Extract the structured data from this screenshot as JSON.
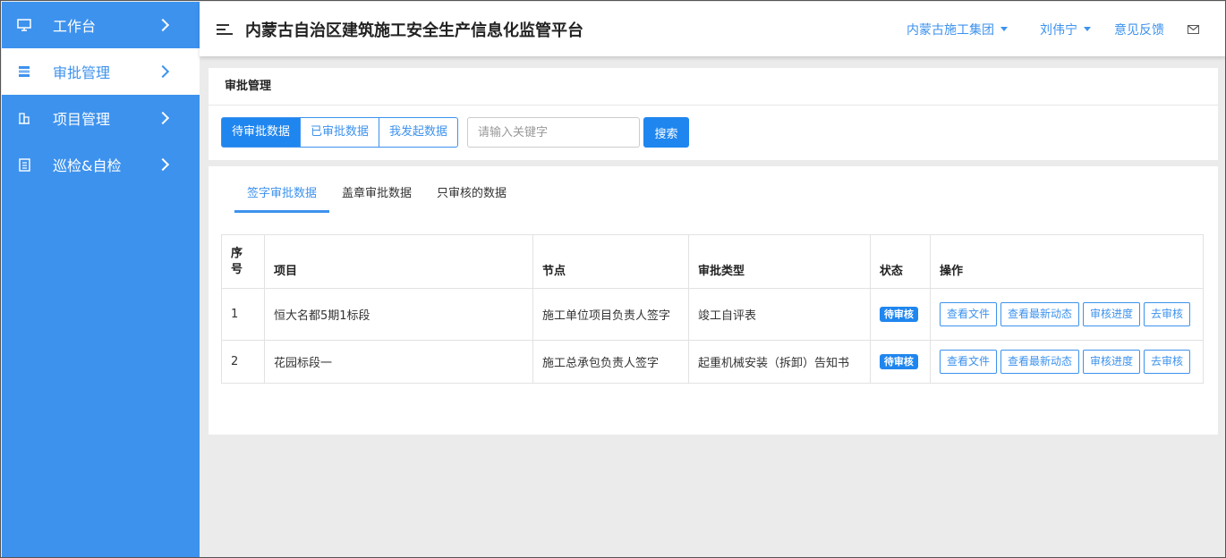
{
  "sidebar": {
    "items": [
      {
        "label": "工作台",
        "icon": "monitor-icon"
      },
      {
        "label": "审批管理",
        "icon": "list-icon"
      },
      {
        "label": "项目管理",
        "icon": "building-icon"
      },
      {
        "label": "巡检&自检",
        "icon": "clipboard-icon"
      }
    ],
    "active_index": 1
  },
  "header": {
    "title": "内蒙古自治区建筑施工安全生产信息化监管平台",
    "org": "内蒙古施工集团",
    "user": "刘伟宁",
    "feedback": "意见反馈"
  },
  "panel": {
    "title": "审批管理",
    "filters": [
      "待审批数据",
      "已审批数据",
      "我发起数据"
    ],
    "active_filter": 0,
    "search_placeholder": "请输入关键字",
    "search_label": "搜索"
  },
  "tabs": {
    "items": [
      "签字审批数据",
      "盖章审批数据",
      "只审核的数据"
    ],
    "active": 0
  },
  "table": {
    "headers": {
      "seq_top": "序",
      "seq_bottom": "号",
      "project": "项目",
      "node": "节点",
      "type": "审批类型",
      "status": "状态",
      "ops": "操作"
    },
    "rows": [
      {
        "seq": "1",
        "project": "恒大名都5期1标段",
        "node": "施工单位项目负责人签字",
        "type": "竣工自评表",
        "status": "待审核"
      },
      {
        "seq": "2",
        "project": "花园标段一",
        "node": "施工总承包负责人签字",
        "type": "起重机械安装（拆卸）告知书",
        "status": "待审核"
      }
    ],
    "actions": [
      "查看文件",
      "查看最新动态",
      "审核进度",
      "去审核"
    ]
  },
  "colors": {
    "primary": "#3d92ee",
    "button": "#1f86ef",
    "background": "#ebebeb"
  }
}
